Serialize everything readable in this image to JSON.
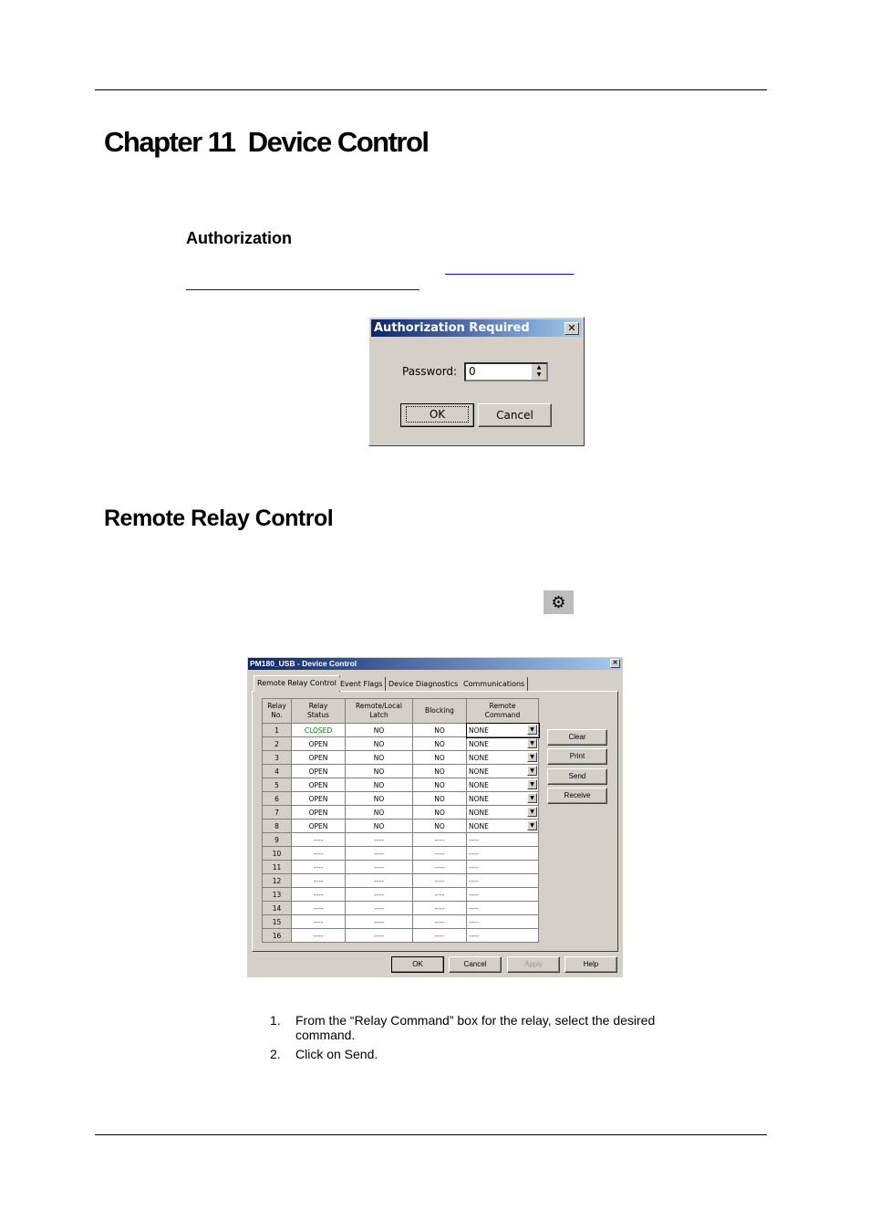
{
  "chapter_title": "Chapter 11  Device Control",
  "section_authorization": "Authorization",
  "section_remote": "Remote Relay Control",
  "auth_dialog": {
    "title": "Authorization Required",
    "password_label": "Password:",
    "password_value": "0",
    "ok": "OK",
    "cancel": "Cancel"
  },
  "toolbar_icon": "device-control-icon",
  "device_dialog": {
    "title": "PM180_USB - Device Control",
    "tabs": [
      "Remote Relay Control",
      "Event Flags",
      "Device Diagnostics",
      "Communications"
    ],
    "headers": [
      [
        "Relay",
        "No."
      ],
      [
        "Relay",
        "Status"
      ],
      [
        "Remote/Local",
        "Latch"
      ],
      [
        "Blocking",
        ""
      ],
      [
        "Remote",
        "Command"
      ]
    ],
    "rows": [
      [
        "1",
        "CLOSED",
        "NO",
        "NO",
        "NONE"
      ],
      [
        "2",
        "OPEN",
        "NO",
        "NO",
        "NONE"
      ],
      [
        "3",
        "OPEN",
        "NO",
        "NO",
        "NONE"
      ],
      [
        "4",
        "OPEN",
        "NO",
        "NO",
        "NONE"
      ],
      [
        "5",
        "OPEN",
        "NO",
        "NO",
        "NONE"
      ],
      [
        "6",
        "OPEN",
        "NO",
        "NO",
        "NONE"
      ],
      [
        "7",
        "OPEN",
        "NO",
        "NO",
        "NONE"
      ],
      [
        "8",
        "OPEN",
        "NO",
        "NO",
        "NONE"
      ],
      [
        "9",
        "----",
        "----",
        "----",
        "----"
      ],
      [
        "10",
        "----",
        "----",
        "----",
        "----"
      ],
      [
        "11",
        "----",
        "----",
        "----",
        "----"
      ],
      [
        "12",
        "----",
        "----",
        "----",
        "----"
      ],
      [
        "13",
        "----",
        "----",
        "----",
        "----"
      ],
      [
        "14",
        "----",
        "----",
        "----",
        "----"
      ],
      [
        "15",
        "----",
        "----",
        "----",
        "----"
      ],
      [
        "16",
        "----",
        "----",
        "----",
        "----"
      ]
    ],
    "side_buttons": [
      "Clear",
      "Print",
      "Send",
      "Receive"
    ],
    "bottom_buttons": [
      "OK",
      "Cancel",
      "Apply",
      "Help"
    ],
    "closed_color": "#008000"
  },
  "steps": [
    {
      "n": "1.",
      "text": "From the “Relay Command” box for the relay, select the desired command."
    },
    {
      "n": "2.",
      "text": "Click on Send."
    }
  ]
}
